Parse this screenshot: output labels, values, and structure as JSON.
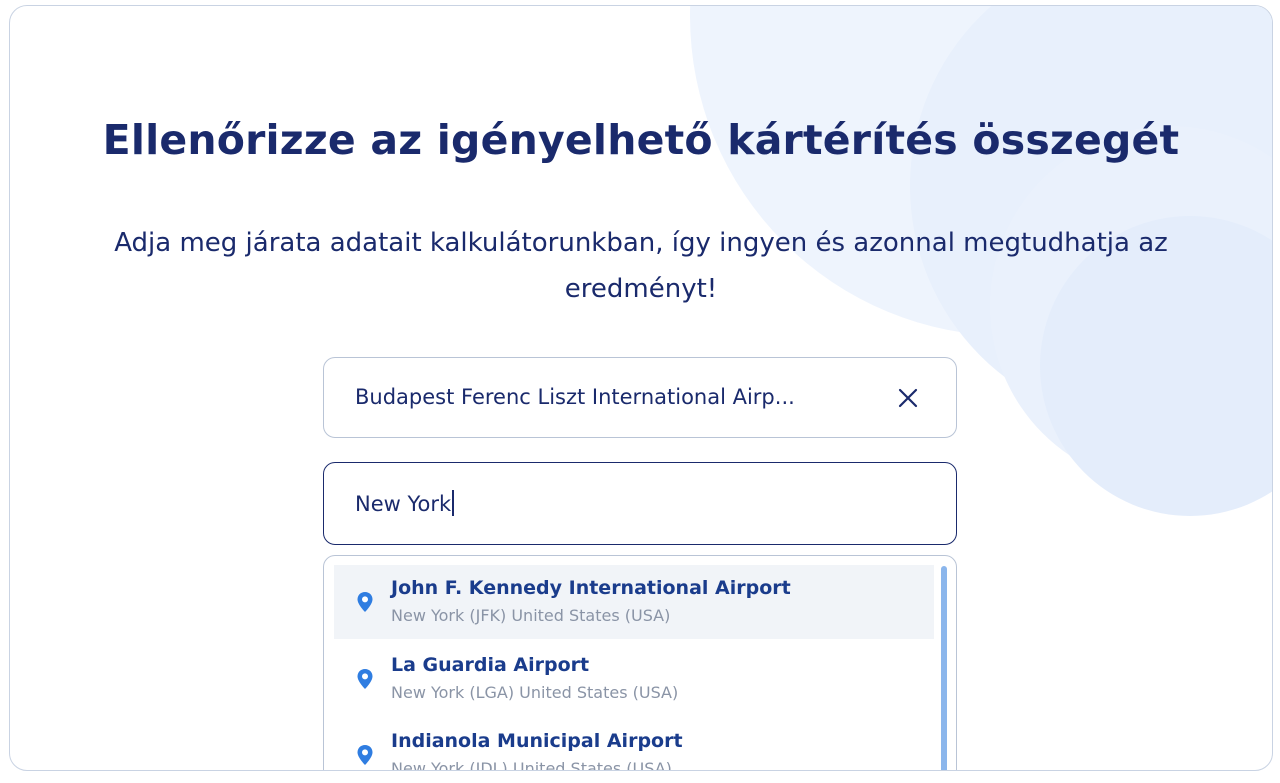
{
  "title": "Ellenőrizze az igényelhető kártérítés összegét",
  "subtitle": "Adja meg járata adatait kalkulátorunkban, így ingyen és azonnal megtudhatja az eredményt!",
  "departure": {
    "value": "Budapest Ferenc Liszt International Airp...",
    "clear_icon": "close-icon"
  },
  "arrival": {
    "value": "New York"
  },
  "suggestions": [
    {
      "name": "John F. Kennedy International Airport",
      "detail": "New York (JFK) United States (USA)",
      "icon": "location-pin-icon"
    },
    {
      "name": "La Guardia Airport",
      "detail": "New York (LGA) United States (USA)",
      "icon": "location-pin-icon"
    },
    {
      "name": "Indianola Municipal Airport",
      "detail": "New York (IDL) United States (USA)",
      "icon": "location-pin-icon"
    }
  ],
  "colors": {
    "heading": "#1a2a6c",
    "option_name": "#1a3c8c",
    "pin": "#2f7de1",
    "scrollbar": "#8bb6ec",
    "hover_bg": "#f1f4f8"
  }
}
